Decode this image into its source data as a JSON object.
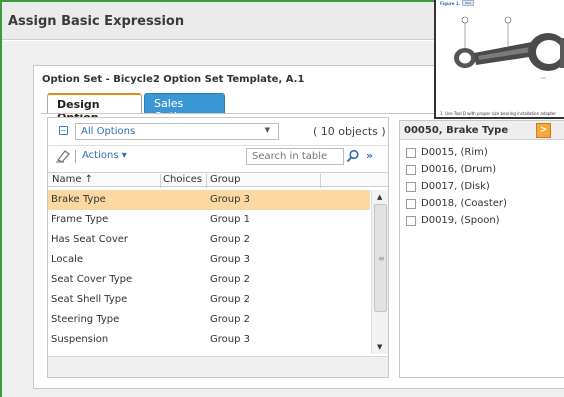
{
  "window": {
    "title": "Assign Basic Expression"
  },
  "option_set": {
    "title": "Option Set - Bicycle2 Option Set Template, A.1"
  },
  "tabs": [
    {
      "label": "Design Option",
      "active": true
    },
    {
      "label": "Sales Option",
      "active": false
    }
  ],
  "filter": {
    "selected": "All Options",
    "count": "( 10 objects )"
  },
  "toolbar": {
    "actions_label": "Actions ▾",
    "search_placeholder": "Search in table"
  },
  "table": {
    "columns": [
      "Name ↑",
      "Choices",
      "Group"
    ],
    "rows": [
      {
        "name": "Brake Type",
        "choices": "",
        "group": "Group 3"
      },
      {
        "name": "Frame Type",
        "choices": "",
        "group": "Group 1"
      },
      {
        "name": "Has Seat Cover",
        "choices": "",
        "group": "Group 2"
      },
      {
        "name": "Locale",
        "choices": "",
        "group": "Group 3"
      },
      {
        "name": "Seat Cover Type",
        "choices": "",
        "group": "Group 2"
      },
      {
        "name": "Seat Shell Type",
        "choices": "",
        "group": "Group 2"
      },
      {
        "name": "Steering Type",
        "choices": "",
        "group": "Group 2"
      },
      {
        "name": "Suspension",
        "choices": "",
        "group": "Group 3"
      }
    ],
    "selected_index": 0
  },
  "choices_panel": {
    "title": "00050, Brake Type",
    "choices": [
      "D0015, (Rim)",
      "D0016, (Drum)",
      "D0017, (Disk)",
      "D0018, (Coaster)",
      "D0019, (Spoon)"
    ]
  },
  "figure_popup": {
    "header": "Figure 1.",
    "badge": "Illus",
    "caption": "1.  Use Tool D with proper size bearing installation adapter"
  },
  "colors": {
    "frame_border": "#3f9a3f",
    "accent_tab": "#3b97d3",
    "selected_row": "#fbd8a2",
    "panel_button": "#f7a83d"
  },
  "icons": [
    "minus-icon",
    "eraser-icon",
    "search-icon",
    "double-chevron-right-icon",
    "chevron-right-icon",
    "caret-down-icon",
    "scroll-up-icon",
    "scroll-down-icon"
  ]
}
